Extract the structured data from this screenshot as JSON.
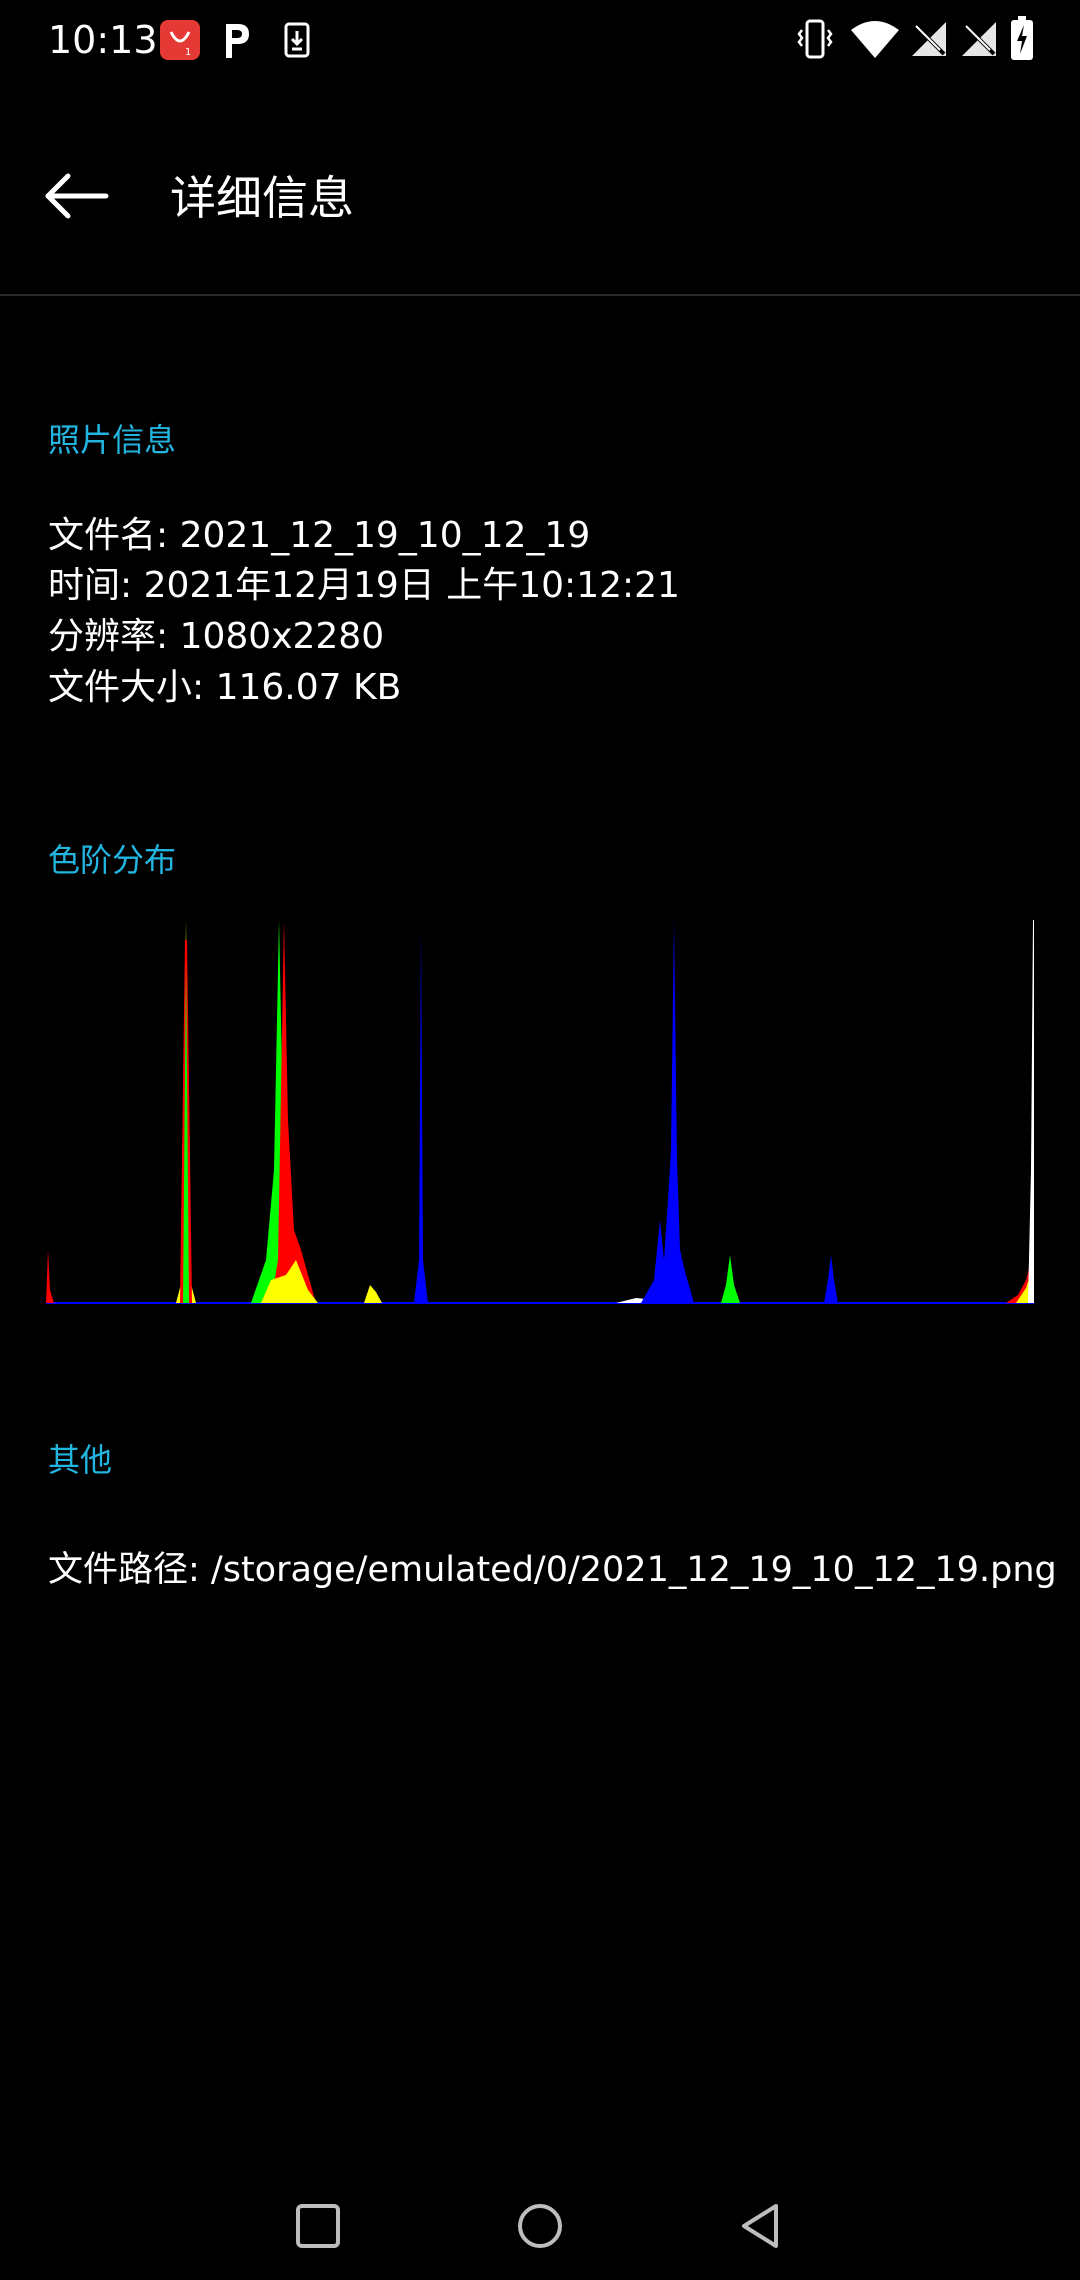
{
  "status_bar": {
    "time": "10:13",
    "left_icons": [
      "notification-shop-icon",
      "parking-app-icon",
      "download-icon"
    ],
    "right_icons": [
      "vibrate-icon",
      "wifi-icon",
      "no-signal-icon",
      "no-signal-icon",
      "battery-charging-icon"
    ]
  },
  "header": {
    "back_icon": "arrow-back-icon",
    "title": "详细信息"
  },
  "photo_info": {
    "section_title": "照片信息",
    "file_name": "文件名: 2021_12_19_10_12_19",
    "time": "时间: 2021年12月19日 上午10:12:21",
    "resolution": "分辨率: 1080x2280",
    "file_size": "文件大小: 116.07 KB"
  },
  "histogram": {
    "section_title": "色阶分布",
    "colors": {
      "red": "#ff0000",
      "green": "#00ff00",
      "blue": "#0000ff",
      "yellow": "#ffff00",
      "white": "#ffffff"
    }
  },
  "other": {
    "section_title": "其他",
    "file_path": "文件路径: /storage/emulated/0/2021_12_19_10_12_19.png"
  },
  "nav_bar": {
    "icons": [
      "recents-square-icon",
      "home-circle-icon",
      "back-triangle-icon"
    ]
  },
  "colors": {
    "accent": "#22b5e0",
    "background": "#000000",
    "text": "#ffffff",
    "divider": "#2b2b2b"
  }
}
